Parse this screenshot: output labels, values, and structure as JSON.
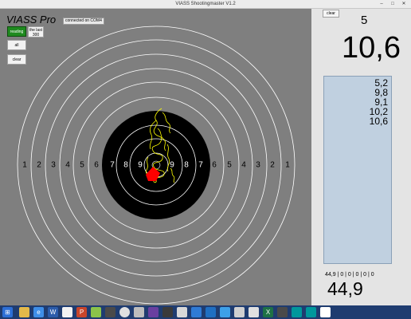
{
  "window": {
    "title": "VIASS Shootingmaster V1.2",
    "controls": [
      "–",
      "□",
      "✕"
    ]
  },
  "app": {
    "name": "VIASS Pro",
    "connection": "connected on COM4"
  },
  "buttons": {
    "active": "reading",
    "last": "the last",
    "last_value": "300",
    "all": "all",
    "clear": "clear"
  },
  "target": {
    "ring_numbers_left": [
      "1",
      "2",
      "3",
      "4",
      "5",
      "6",
      "7",
      "8",
      "9"
    ],
    "ring_numbers_right": [
      "9",
      "8",
      "7",
      "6",
      "5",
      "4",
      "3",
      "2",
      "1"
    ],
    "colors": {
      "black": "#000000",
      "white_ring": "#ffffff",
      "trace": "#ffff00",
      "hit": "#ff0000"
    }
  },
  "score_panel": {
    "clear": "clear",
    "shot_number": "5",
    "current_score": "10,6",
    "shots": [
      "5,2",
      "9,8",
      "9,1",
      "10,2",
      "10,6"
    ],
    "series_summary": "44,9 | 0 | 0 | 0 | 0 | 0",
    "total": "44,9"
  },
  "taskbar": {
    "icons": [
      "start-icon",
      "explorer-icon",
      "ie-icon",
      "word-icon",
      "paint-icon",
      "powerpoint-icon",
      "bluestacks-icon",
      "chrome-icon",
      "settings-icon",
      "visual-studio-icon",
      "app-icon",
      "windows-icon",
      "outlook-icon",
      "store-icon",
      "photos-icon",
      "excel-icon",
      "arduino-icon",
      "arduino2-icon",
      "viass-icon"
    ]
  }
}
